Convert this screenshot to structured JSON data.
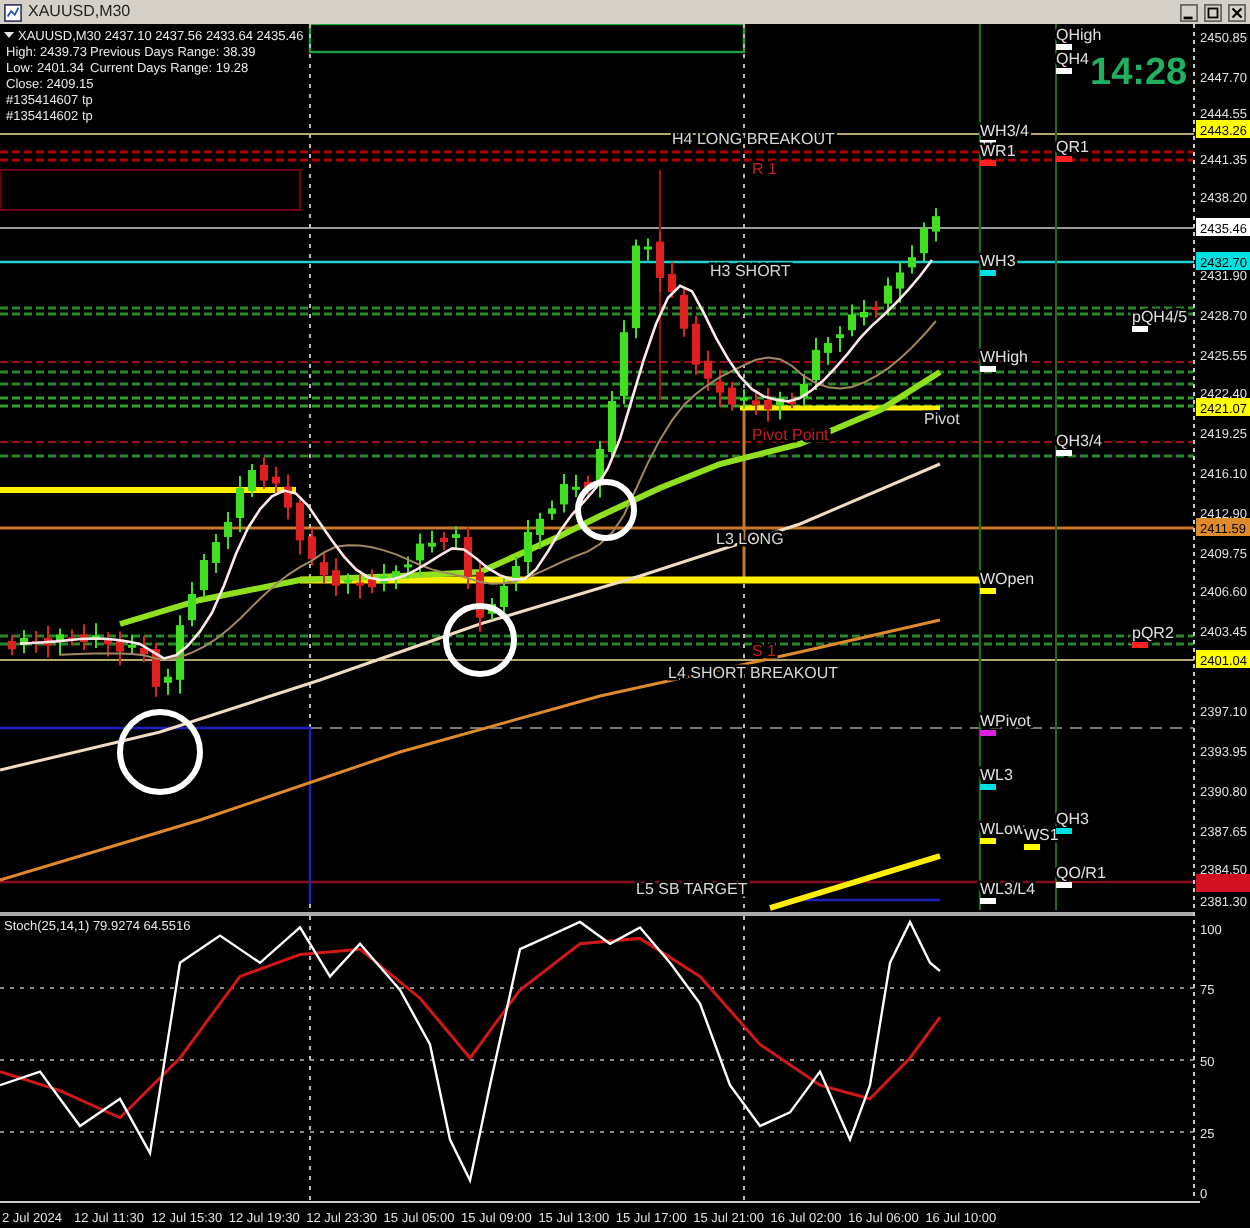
{
  "window": {
    "title": "XAUUSD,M30"
  },
  "info": {
    "header": "XAUUSD,M30  2437.10 2437.56 2433.64 2435.46",
    "lines": [
      "High: 2439.73",
      "Previous Days Range: 38.39",
      "Low: 2401.34",
      "Current Days Range: 19.28",
      "Close: 2409.15"
    ],
    "orders": [
      "#135414607 tp",
      "#135414602 tp"
    ]
  },
  "clock": "14:28",
  "level_labels": [
    {
      "text": "H4 LONG BREAKOUT",
      "color": "#d8d8d8"
    },
    {
      "text": "R 1",
      "color": "#c02020"
    },
    {
      "text": "H3 SHORT",
      "color": "#d8d8d8"
    },
    {
      "text": "Pivot Point",
      "color": "#c02020"
    },
    {
      "text": "Pivot",
      "color": "#d8d8d8"
    },
    {
      "text": "L3 LONG",
      "color": "#d8d8d8"
    },
    {
      "text": "S 1",
      "color": "#c02020"
    },
    {
      "text": "L4 SHORT BREAKOUT",
      "color": "#d8d8d8"
    },
    {
      "text": "L5 SB TARGET",
      "color": "#d8d8d8"
    }
  ],
  "right_markers": [
    {
      "label": "QHigh",
      "color": "#ffffff"
    },
    {
      "label": "QH4",
      "color": "#ffffff"
    },
    {
      "label": "WH3/4",
      "color": "#ffffff"
    },
    {
      "label": "WR1",
      "color": "#ff2020"
    },
    {
      "label": "QR1",
      "color": "#ff2020"
    },
    {
      "label": "WH3",
      "color": "#00e0e0"
    },
    {
      "label": "pQH4/5",
      "color": "#ffffff"
    },
    {
      "label": "WHigh",
      "color": "#ffffff"
    },
    {
      "label": "QH3/4",
      "color": "#ffffff"
    },
    {
      "label": "WOpen",
      "color": "#ffff00"
    },
    {
      "label": "pQR2",
      "color": "#ff2020"
    },
    {
      "label": "WPivot",
      "color": "#e020e0"
    },
    {
      "label": "WL3",
      "color": "#00e0e0"
    },
    {
      "label": "WLow",
      "color": "#ffff00"
    },
    {
      "label": "WS1",
      "color": "#ffff00"
    },
    {
      "label": "QH3",
      "color": "#00e0e0"
    },
    {
      "label": "QO/R1",
      "color": "#ffffff"
    },
    {
      "label": "WL3/L4",
      "color": "#ffffff"
    }
  ],
  "price_axis": {
    "ticks": [
      "2450.85",
      "2447.70",
      "2444.55",
      "2441.35",
      "2438.20",
      "2431.90",
      "2428.70",
      "2425.55",
      "2422.40",
      "2419.25",
      "2416.10",
      "2412.90",
      "2409.75",
      "2406.60",
      "2403.45",
      "2397.10",
      "2393.95",
      "2390.80",
      "2387.65",
      "2384.50",
      "2381.30"
    ],
    "tags": [
      {
        "text": "2443.26",
        "color": "#ffff00"
      },
      {
        "text": "2435.46",
        "color": "#ffffff"
      },
      {
        "text": "2432.70",
        "color": "#00e0e0"
      },
      {
        "text": "2421.07",
        "color": "#ffff00"
      },
      {
        "text": "2411.59",
        "color": "#e08a2c"
      },
      {
        "text": "2401.04",
        "color": "#ffff00"
      }
    ]
  },
  "stochastic": {
    "title": "Stoch(25,14,1) 79.9274 64.5516",
    "scale": [
      "100",
      "75",
      "50",
      "25",
      "0"
    ]
  },
  "time_axis": [
    "2 Jul 2024",
    "12 Jul 11:30",
    "12 Jul 15:30",
    "12 Jul 19:30",
    "12 Jul 23:30",
    "15 Jul 05:00",
    "15 Jul 09:00",
    "15 Jul 13:00",
    "15 Jul 17:00",
    "15 Jul 21:00",
    "16 Jul 02:00",
    "16 Jul 06:00",
    "16 Jul 10:00"
  ]
}
